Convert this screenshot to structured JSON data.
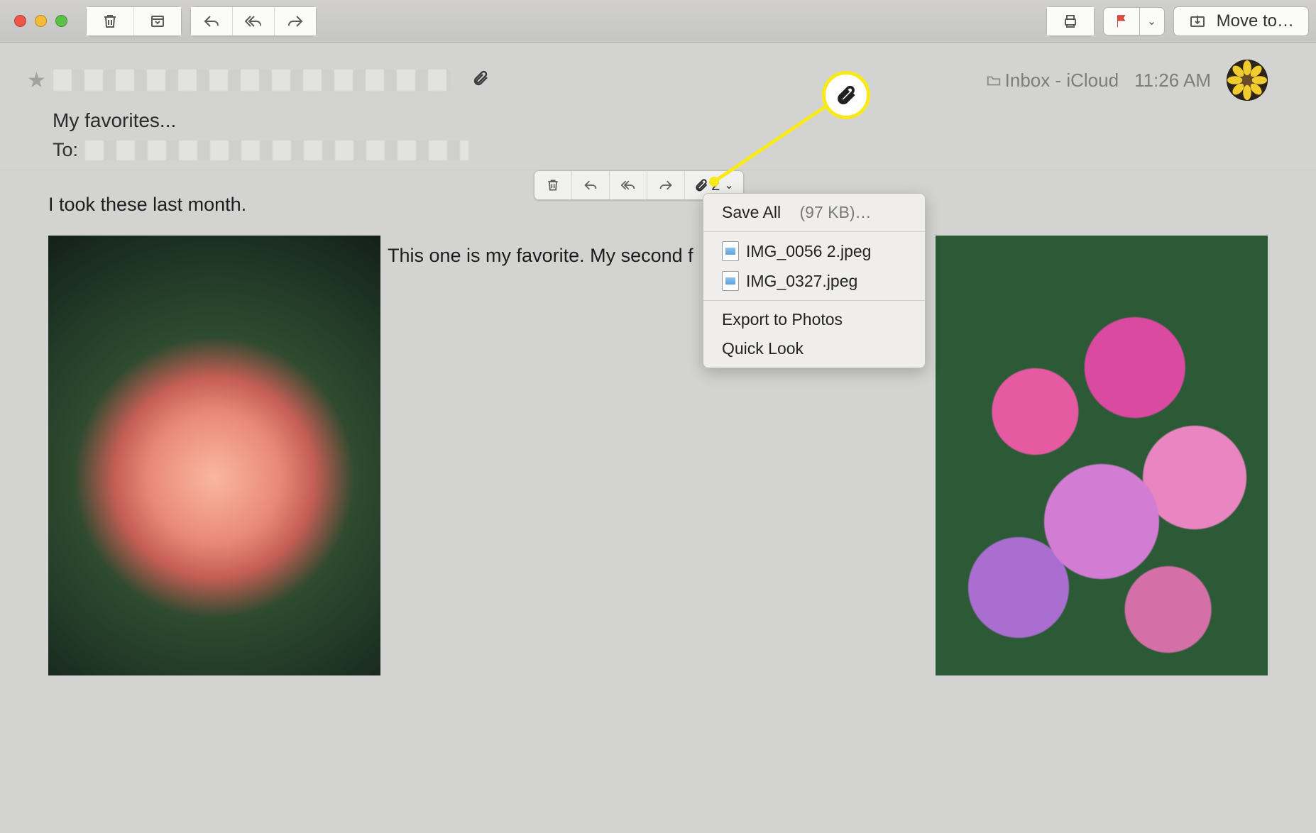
{
  "toolbar": {
    "move_to_label": "Move to…"
  },
  "header": {
    "folder_label": "Inbox - iCloud",
    "time": "11:26 AM",
    "subject": "My favorites...",
    "to_prefix": "To:"
  },
  "float_toolbar": {
    "attachment_count": "2"
  },
  "dropdown": {
    "save_all_label": "Save All",
    "save_all_size": "(97 KB)…",
    "attachments": [
      "IMG_0056 2.jpeg",
      "IMG_0327.jpeg"
    ],
    "export_label": "Export to Photos",
    "quicklook_label": "Quick Look"
  },
  "body": {
    "line1": "I took these last month.",
    "line2": "This one is my favorite. My second f"
  }
}
